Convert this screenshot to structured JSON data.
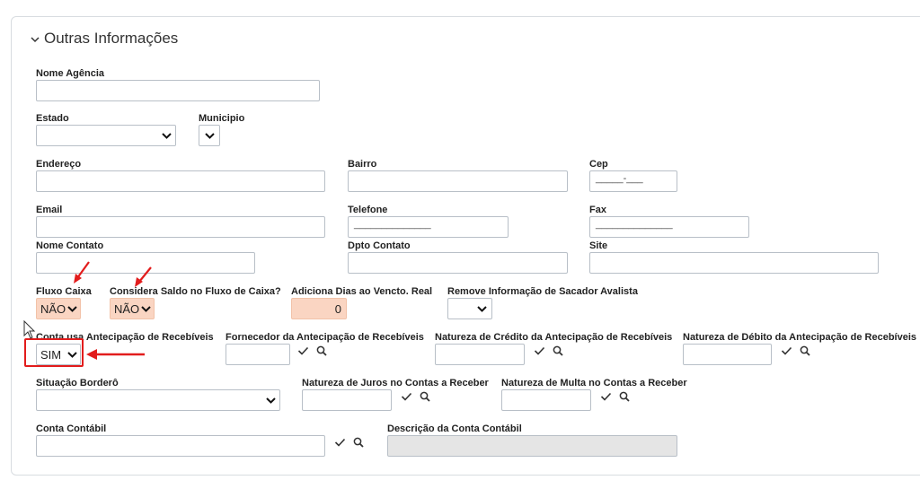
{
  "section": {
    "title": "Outras Informações"
  },
  "fields": {
    "nome_agencia": {
      "label": "Nome Agência",
      "value": ""
    },
    "estado": {
      "label": "Estado",
      "value": ""
    },
    "municipio": {
      "label": "Municipio",
      "value": ""
    },
    "endereco": {
      "label": "Endereço",
      "value": ""
    },
    "bairro": {
      "label": "Bairro",
      "value": ""
    },
    "cep": {
      "label": "Cep",
      "mask": "_____-___"
    },
    "email": {
      "label": "Email",
      "value": ""
    },
    "telefone": {
      "label": "Telefone",
      "mask": "______________"
    },
    "fax": {
      "label": "Fax",
      "mask": "______________"
    },
    "nome_contato": {
      "label": "Nome Contato",
      "value": ""
    },
    "dpto_contato": {
      "label": "Dpto Contato",
      "value": ""
    },
    "site": {
      "label": "Site",
      "value": ""
    },
    "fluxo_caixa": {
      "label": "Fluxo Caixa",
      "value": "NÃO"
    },
    "considera_saldo": {
      "label": "Considera Saldo no Fluxo de Caixa?",
      "value": "NÃO"
    },
    "adiciona_dias": {
      "label": "Adiciona Dias ao Vencto. Real",
      "value": "0"
    },
    "remove_info_sacador": {
      "label": "Remove Informação de Sacador Avalista",
      "value": ""
    },
    "conta_antecipacao": {
      "label": "Conta usa Antecipação de Recebíveis",
      "value": "SIM"
    },
    "fornecedor_antecipacao": {
      "label": "Fornecedor da Antecipação de Recebíveis",
      "value": ""
    },
    "natureza_credito_antecipacao": {
      "label": "Natureza de Crédito da Antecipação de Recebíveis",
      "value": ""
    },
    "natureza_debito_antecipacao": {
      "label": "Natureza de Débito da Antecipação de Recebíveis",
      "value": ""
    },
    "situacao_bordero": {
      "label": "Situação Borderô",
      "value": ""
    },
    "natureza_juros": {
      "label": "Natureza de Juros no Contas a Receber",
      "value": ""
    },
    "natureza_multa": {
      "label": "Natureza de Multa no Contas a Receber",
      "value": ""
    },
    "conta_contabil": {
      "label": "Conta Contábil",
      "value": ""
    },
    "descricao_conta_contabil": {
      "label": "Descrição da Conta Contábil",
      "value": ""
    }
  },
  "icons": {
    "confirm": "check-icon",
    "search": "search-icon",
    "dropdown": "chevron-down-icon"
  },
  "colors": {
    "highlight_bg": "#fad5c2",
    "annotation_red": "#e21c1c"
  }
}
